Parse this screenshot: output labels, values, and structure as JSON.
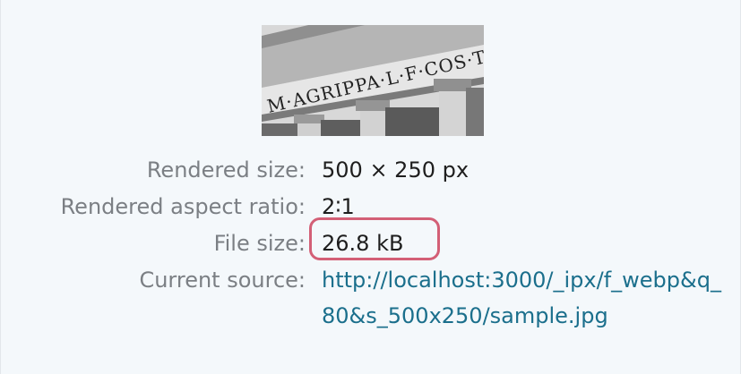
{
  "preview": {
    "image_caption": "M·AGRIPPA·L·F·COS·TERT"
  },
  "details": {
    "rendered_size_label": "Rendered size:",
    "rendered_size_value": "500 × 250 px",
    "aspect_ratio_label": "Rendered aspect ratio:",
    "aspect_ratio_value": "2∶1",
    "file_size_label": "File size:",
    "file_size_value": "26.8 kB",
    "current_source_label": "Current source:",
    "current_source_value": "http://localhost:3000/_ipx/f_webp&q_80&s_500x250/sample.jpg"
  },
  "colors": {
    "background": "#f4f8fb",
    "label": "#7b7f84",
    "value": "#1e1e1e",
    "link": "#1b6f8c",
    "highlight": "#d35f76"
  }
}
